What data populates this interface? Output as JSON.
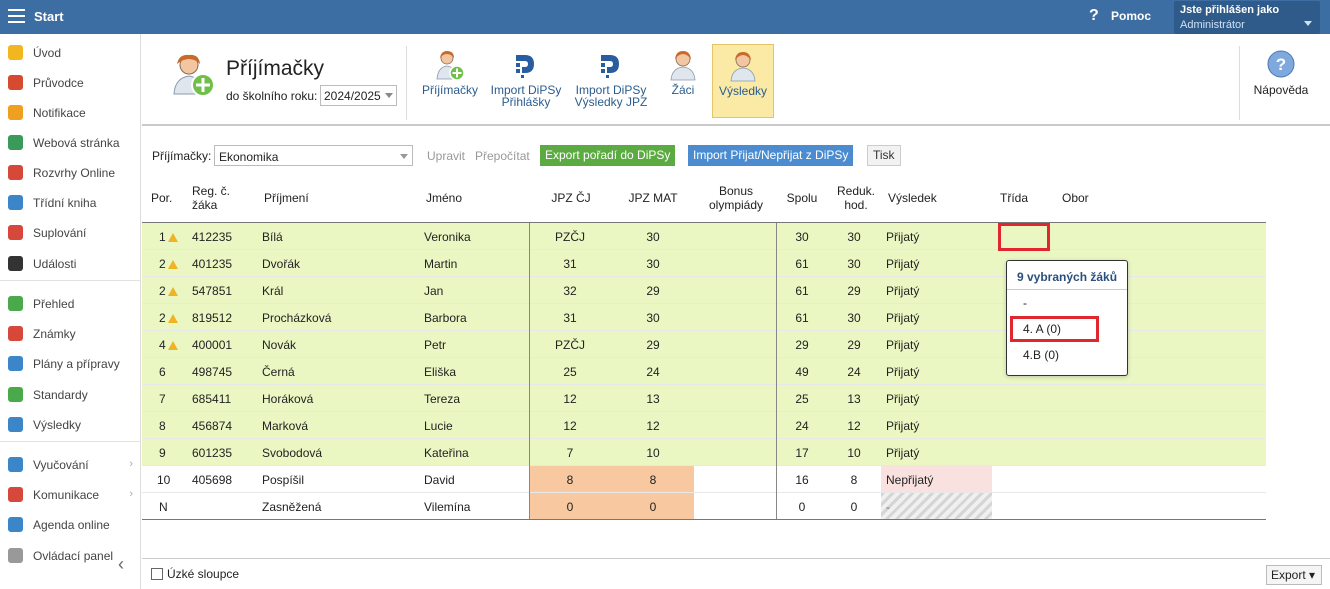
{
  "topbar": {
    "start": "Start",
    "help": "Pomoc",
    "user_line1": "Jste přihlášen jako",
    "user_line2": "Administrátor"
  },
  "sidebar": {
    "items": [
      {
        "label": "Úvod",
        "icon": "star-icon",
        "color": "#f2b71f"
      },
      {
        "label": "Průvodce",
        "icon": "wand-icon",
        "color": "#d64a2f"
      },
      {
        "label": "Notifikace",
        "icon": "envelope-icon",
        "color": "#f0a020"
      },
      {
        "label": "Webová stránka",
        "icon": "home-icon",
        "color": "#3a9a5a"
      },
      {
        "label": "Rozvrhy Online",
        "icon": "calendar-grid-icon",
        "color": "#d6483a"
      },
      {
        "label": "Třídní kniha",
        "icon": "book-icon",
        "color": "#3a86c8"
      },
      {
        "label": "Suplování",
        "icon": "person-swap-icon",
        "color": "#d6483a"
      },
      {
        "label": "Události",
        "icon": "calendar-icon",
        "color": "#333333"
      },
      {
        "label": "Přehled",
        "icon": "check-circle-icon",
        "color": "#4aaa4a"
      },
      {
        "label": "Známky",
        "icon": "grade-icon",
        "color": "#d6483a"
      },
      {
        "label": "Plány a přípravy",
        "icon": "briefcase-icon",
        "color": "#3a86c8"
      },
      {
        "label": "Standardy",
        "icon": "shield-check-icon",
        "color": "#4aaa4a"
      },
      {
        "label": "Výsledky",
        "icon": "bar-chart-icon",
        "color": "#3a86c8"
      },
      {
        "label": "Vyučování",
        "icon": "open-book-icon",
        "color": "#3a86c8"
      },
      {
        "label": "Komunikace",
        "icon": "chat-icon",
        "color": "#d6483a"
      },
      {
        "label": "Agenda online",
        "icon": "pencil-icon",
        "color": "#3a86c8"
      },
      {
        "label": "Ovládací panel",
        "icon": "gear-icon",
        "color": "#999999"
      }
    ]
  },
  "toolbar": {
    "title": "Příjímačky",
    "year_label": "do školního roku:",
    "year_value": "2024/2025",
    "buttons": [
      {
        "label": "Příjímačky",
        "icon": "person-add-icon"
      },
      {
        "label": "Import DiPSy Přihlášky",
        "icon": "dipsy-icon"
      },
      {
        "label": "Import DiPSy Výsledky JPZ",
        "icon": "dipsy-icon"
      },
      {
        "label": "Žáci",
        "icon": "person-icon"
      },
      {
        "label": "Výsledky",
        "icon": "person-icon"
      }
    ],
    "help": "Nápověda"
  },
  "filters": {
    "label": "Příjímačky:",
    "select_value": "Ekonomika",
    "edit": "Upravit",
    "recalc": "Přepočítat",
    "export_btn": "Export pořadí do DiPSy",
    "import_btn": "Import Přijat/Nepřijat z DiPSy",
    "print_btn": "Tisk"
  },
  "table": {
    "columns": [
      "Por.",
      "Reg. č. žáka",
      "Příjmení",
      "Jméno",
      "JPZ ČJ",
      "JPZ MAT",
      "Bonus olympiády",
      "Spolu",
      "Reduk. hod.",
      "Výsledek",
      "Třída",
      "Obor"
    ],
    "rows": [
      {
        "por": "1",
        "warn": true,
        "reg": "412235",
        "surname": "Bílá",
        "name": "Veronika",
        "cj": "PZČJ",
        "mat": "30",
        "bonus": "",
        "total": "30",
        "red": "30",
        "result": "Přijatý",
        "status": "pass"
      },
      {
        "por": "2",
        "warn": true,
        "reg": "401235",
        "surname": "Dvořák",
        "name": "Martin",
        "cj": "31",
        "mat": "30",
        "bonus": "",
        "total": "61",
        "red": "30",
        "result": "Přijatý",
        "status": "pass"
      },
      {
        "por": "2",
        "warn": true,
        "reg": "547851",
        "surname": "Král",
        "name": "Jan",
        "cj": "32",
        "mat": "29",
        "bonus": "",
        "total": "61",
        "red": "29",
        "result": "Přijatý",
        "status": "pass"
      },
      {
        "por": "2",
        "warn": true,
        "reg": "819512",
        "surname": "Procházková",
        "name": "Barbora",
        "cj": "31",
        "mat": "30",
        "bonus": "",
        "total": "61",
        "red": "30",
        "result": "Přijatý",
        "status": "pass"
      },
      {
        "por": "4",
        "warn": true,
        "reg": "400001",
        "surname": "Novák",
        "name": "Petr",
        "cj": "PZČJ",
        "mat": "29",
        "bonus": "",
        "total": "29",
        "red": "29",
        "result": "Přijatý",
        "status": "pass"
      },
      {
        "por": "6",
        "warn": false,
        "reg": "498745",
        "surname": "Černá",
        "name": "Eliška",
        "cj": "25",
        "mat": "24",
        "bonus": "",
        "total": "49",
        "red": "24",
        "result": "Přijatý",
        "status": "pass"
      },
      {
        "por": "7",
        "warn": false,
        "reg": "685411",
        "surname": "Horáková",
        "name": "Tereza",
        "cj": "12",
        "mat": "13",
        "bonus": "",
        "total": "25",
        "red": "13",
        "result": "Přijatý",
        "status": "pass"
      },
      {
        "por": "8",
        "warn": false,
        "reg": "456874",
        "surname": "Marková",
        "name": "Lucie",
        "cj": "12",
        "mat": "12",
        "bonus": "",
        "total": "24",
        "red": "12",
        "result": "Přijatý",
        "status": "pass"
      },
      {
        "por": "9",
        "warn": false,
        "reg": "601235",
        "surname": "Svobodová",
        "name": "Kateřina",
        "cj": "7",
        "mat": "10",
        "bonus": "",
        "total": "17",
        "red": "10",
        "result": "Přijatý",
        "status": "pass"
      },
      {
        "por": "10",
        "warn": false,
        "reg": "405698",
        "surname": "Pospíšil",
        "name": "David",
        "cj": "8",
        "mat": "8",
        "bonus": "",
        "total": "16",
        "red": "8",
        "result": "Nepřijatý",
        "status": "fail"
      },
      {
        "por": "N",
        "warn": false,
        "reg": "",
        "surname": "Zasněžená",
        "name": "Vilemína",
        "cj": "0",
        "mat": "0",
        "bonus": "",
        "total": "0",
        "red": "0",
        "result": "-",
        "status": "none"
      }
    ]
  },
  "popup": {
    "header": "9 vybraných žáků",
    "options": [
      "-",
      "4. A (0)",
      "4.B (0)"
    ]
  },
  "footer": {
    "checkbox_label": "Úzké sloupce",
    "export": "Export ▾"
  },
  "colors": {
    "topbar": "#3d6ea3",
    "pass_row": "#eaf7c3",
    "fail_cell": "#f8c9a0",
    "highlight": "#e0262e"
  }
}
